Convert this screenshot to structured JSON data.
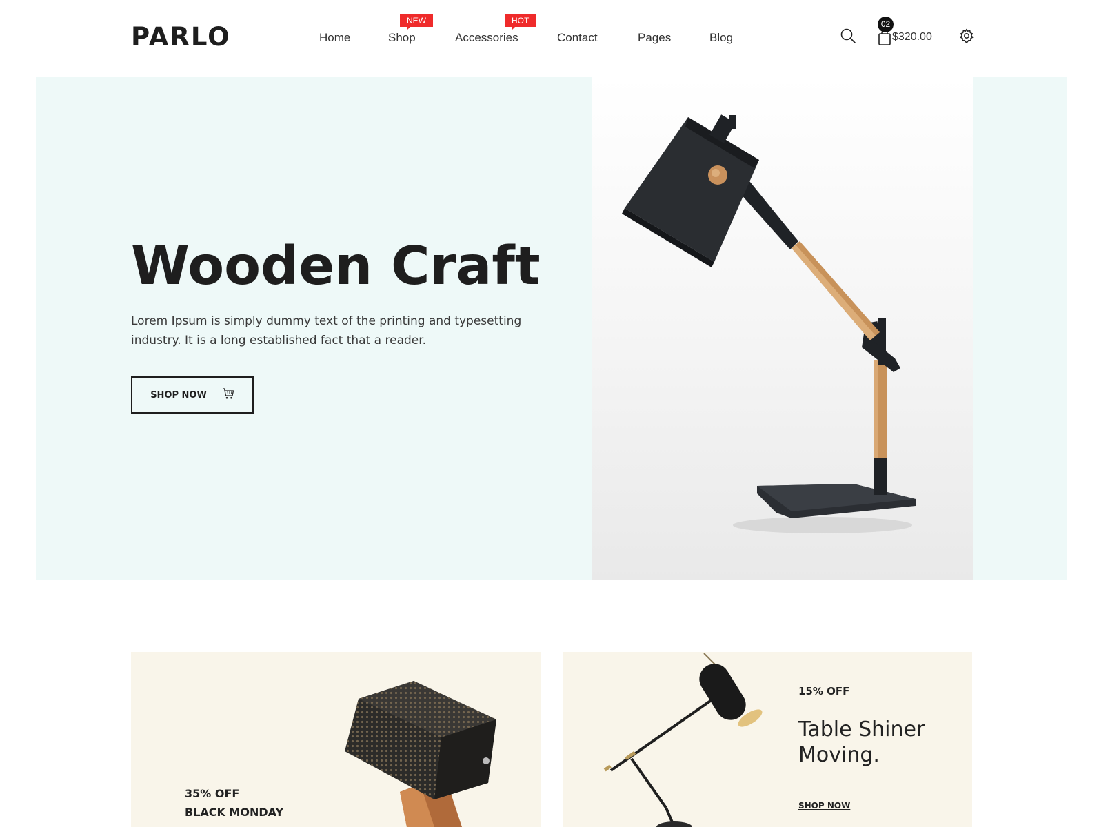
{
  "header": {
    "logo": "PARLO",
    "nav": [
      {
        "label": "Home"
      },
      {
        "label": "Shop",
        "badge": "NEW"
      },
      {
        "label": "Accessories",
        "badge": "HOT"
      },
      {
        "label": "Contact"
      },
      {
        "label": "Pages"
      },
      {
        "label": "Blog"
      }
    ],
    "cart_count": "02",
    "cart_total": "$320.00",
    "icons": [
      "search-icon",
      "shopping-bag-icon",
      "gear-icon"
    ]
  },
  "hero": {
    "title": "Wooden Craft",
    "description": "Lorem Ipsum is simply dummy text of the printing and typesetting industry. It is a long established fact that a reader.",
    "button_label": "SHOP NOW",
    "button_icon": "cart-icon",
    "image": "desk-lamp-black-shade-wooden-arm"
  },
  "promos": [
    {
      "discount": "35% OFF",
      "headline": "BLACK MONDAY",
      "image": "perforated-cube-lamp"
    },
    {
      "discount": "15% OFF",
      "title": "Table Shiner Moving.",
      "link": "SHOP NOW",
      "image": "black-spotlight-table-lamp"
    }
  ],
  "colors": {
    "hero_bg": "#eef9f8",
    "promo_bg": "#f9f5ea",
    "badge": "#ef2b2b",
    "text": "#1e1e1e"
  }
}
